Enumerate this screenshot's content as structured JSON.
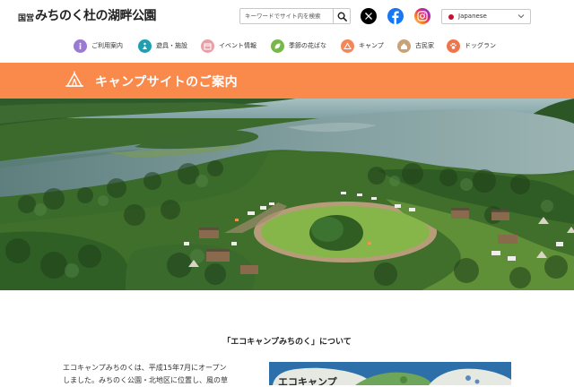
{
  "header": {
    "logo_small": "国営",
    "logo_main": "みちのく杜の湖畔公園",
    "search_placeholder": "キーワードでサイト内を検索",
    "language": "Japanese"
  },
  "social": [
    {
      "name": "x-icon",
      "color": "#000000"
    },
    {
      "name": "facebook-icon",
      "color": "#1877f2"
    },
    {
      "name": "instagram-icon",
      "color": "#d62976"
    }
  ],
  "nav": {
    "items": [
      {
        "label": "ご利用案内",
        "color": "#9b7ad1"
      },
      {
        "label": "遊具・施設",
        "color": "#1f9fb0"
      },
      {
        "label": "イベント情報",
        "color": "#e8a0a8"
      },
      {
        "label": "季節の花ばな",
        "color": "#78b84a"
      },
      {
        "label": "キャンプ",
        "color": "#f2885a"
      },
      {
        "label": "古民家",
        "color": "#c9a27a"
      },
      {
        "label": "ドッグラン",
        "color": "#f0744a"
      }
    ]
  },
  "banner": {
    "title": "キャンプサイトのご案内",
    "color": "#f98a4b"
  },
  "content": {
    "section_title": "「エコキャンプみちのく」について",
    "intro_line1": "エコキャンプみちのくは、平成15年7月にオープン",
    "intro_line2": "しました。みちのく公園・北地区に位置し、風の草",
    "map_label": "エコキャンプ"
  }
}
